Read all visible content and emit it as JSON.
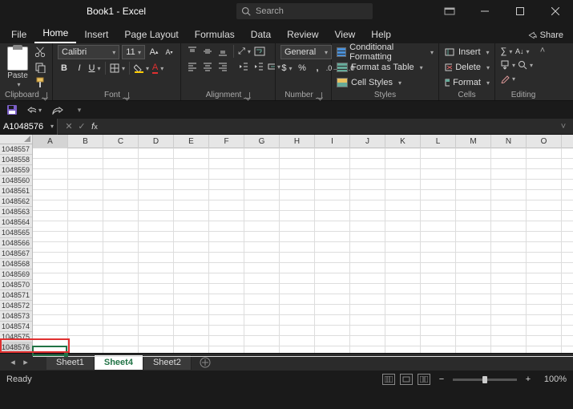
{
  "titlebar": {
    "title": "Book1 - Excel",
    "search_placeholder": "Search"
  },
  "menu": {
    "tabs": [
      "File",
      "Home",
      "Insert",
      "Page Layout",
      "Formulas",
      "Data",
      "Review",
      "View",
      "Help"
    ],
    "active": "Home",
    "share": "Share"
  },
  "ribbon": {
    "clipboard": {
      "paste": "Paste",
      "label": "Clipboard"
    },
    "font": {
      "name": "Calibri",
      "size": "11",
      "label": "Font"
    },
    "alignment": {
      "label": "Alignment"
    },
    "number": {
      "format": "General",
      "label": "Number"
    },
    "styles": {
      "cond": "Conditional Formatting",
      "table": "Format as Table",
      "cell": "Cell Styles",
      "label": "Styles"
    },
    "cells": {
      "insert": "Insert",
      "delete": "Delete",
      "format": "Format",
      "label": "Cells"
    },
    "editing": {
      "label": "Editing"
    }
  },
  "namebox": {
    "ref": "A1048576"
  },
  "grid": {
    "columns": [
      "A",
      "B",
      "C",
      "D",
      "E",
      "F",
      "G",
      "H",
      "I",
      "J",
      "K",
      "L",
      "M",
      "N",
      "O"
    ],
    "rows": [
      1048557,
      1048558,
      1048559,
      1048560,
      1048561,
      1048562,
      1048563,
      1048564,
      1048565,
      1048566,
      1048567,
      1048568,
      1048569,
      1048570,
      1048571,
      1048572,
      1048573,
      1048574,
      1048575,
      1048576
    ],
    "active_row_index": 19,
    "active_col_index": 0
  },
  "sheets": {
    "tabs": [
      "Sheet1",
      "Sheet4",
      "Sheet2"
    ],
    "active": "Sheet4"
  },
  "status": {
    "ready": "Ready",
    "zoom": "100%"
  }
}
